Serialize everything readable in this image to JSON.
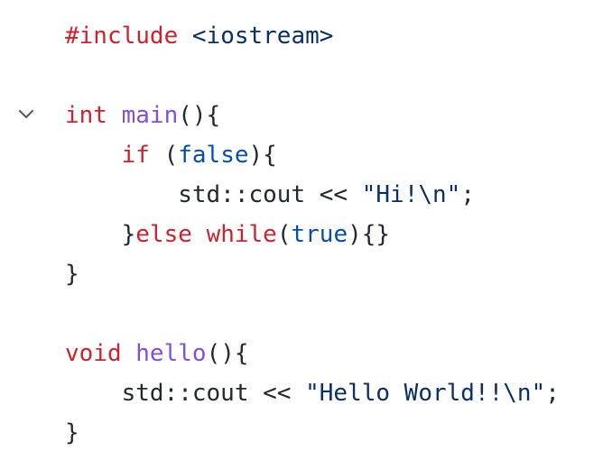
{
  "editor": {
    "fold_icon": "chevron-down-icon",
    "lines": [
      {
        "tokens": [
          {
            "text": "#include",
            "cls": "kw"
          },
          {
            "text": " <iostream>",
            "cls": "str"
          }
        ]
      },
      {
        "tokens": []
      },
      {
        "tokens": [
          {
            "text": "int",
            "cls": "kw"
          },
          {
            "text": " ",
            "cls": "pun"
          },
          {
            "text": "main",
            "cls": "fn"
          },
          {
            "text": "(){",
            "cls": "pun"
          }
        ]
      },
      {
        "tokens": [
          {
            "text": "    ",
            "cls": "pun"
          },
          {
            "text": "if",
            "cls": "kw"
          },
          {
            "text": " (",
            "cls": "pun"
          },
          {
            "text": "false",
            "cls": "lit"
          },
          {
            "text": "){",
            "cls": "pun"
          }
        ]
      },
      {
        "tokens": [
          {
            "text": "        std::cout << ",
            "cls": "pun"
          },
          {
            "text": "\"Hi!\\n\"",
            "cls": "str"
          },
          {
            "text": ";",
            "cls": "pun"
          }
        ]
      },
      {
        "tokens": [
          {
            "text": "    }",
            "cls": "pun"
          },
          {
            "text": "else",
            "cls": "kw"
          },
          {
            "text": " ",
            "cls": "pun"
          },
          {
            "text": "while",
            "cls": "kw"
          },
          {
            "text": "(",
            "cls": "pun"
          },
          {
            "text": "true",
            "cls": "lit"
          },
          {
            "text": "){}",
            "cls": "pun"
          }
        ]
      },
      {
        "tokens": [
          {
            "text": "}",
            "cls": "pun"
          }
        ]
      },
      {
        "tokens": []
      },
      {
        "tokens": [
          {
            "text": "void",
            "cls": "kw"
          },
          {
            "text": " ",
            "cls": "pun"
          },
          {
            "text": "hello",
            "cls": "fn"
          },
          {
            "text": "(){",
            "cls": "pun"
          }
        ]
      },
      {
        "tokens": [
          {
            "text": "    std::cout << ",
            "cls": "pun"
          },
          {
            "text": "\"Hello World!!\\n\"",
            "cls": "str"
          },
          {
            "text": ";",
            "cls": "pun"
          }
        ]
      },
      {
        "tokens": [
          {
            "text": "}",
            "cls": "pun"
          }
        ]
      }
    ]
  }
}
